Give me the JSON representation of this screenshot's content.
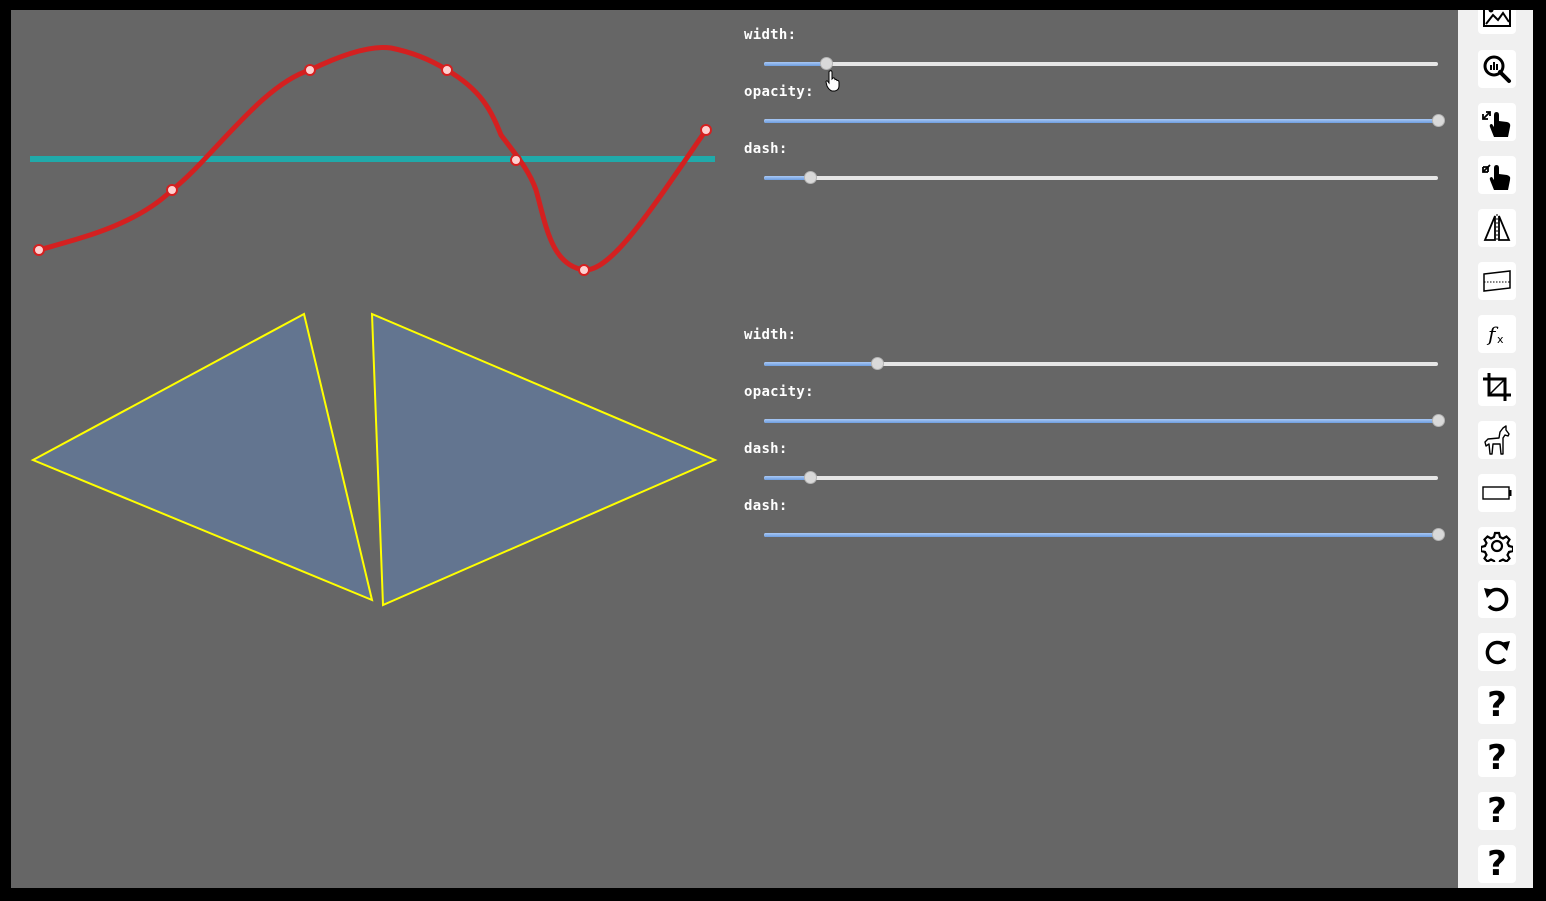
{
  "canvas": {
    "background": "#666666",
    "curve_color": "#d42020",
    "line_color": "#20aaaa",
    "triangle_fill": "#637590",
    "triangle_stroke": "#ffff00"
  },
  "panel1": {
    "sliders": [
      {
        "label": "width:",
        "value": 0.092
      },
      {
        "label": "opacity:",
        "value": 1.0
      },
      {
        "label": "dash:",
        "value": 0.068
      }
    ]
  },
  "panel2": {
    "sliders": [
      {
        "label": "width:",
        "value": 0.168
      },
      {
        "label": "opacity:",
        "value": 1.0
      },
      {
        "label": "dash:",
        "value": 0.068
      },
      {
        "label": "dash:",
        "value": 1.0
      }
    ]
  },
  "toolbar": {
    "tools": [
      {
        "icon": "image-icon"
      },
      {
        "icon": "zoom-chart-icon"
      },
      {
        "icon": "hand-expand-icon"
      },
      {
        "icon": "hand-shrink-icon"
      },
      {
        "icon": "mirror-icon"
      },
      {
        "icon": "skew-rect-icon"
      },
      {
        "icon": "function-icon",
        "text": "fx"
      },
      {
        "icon": "crop-icon"
      },
      {
        "icon": "horse-icon"
      },
      {
        "icon": "battery-icon"
      },
      {
        "icon": "gear-icon"
      },
      {
        "icon": "undo-icon"
      },
      {
        "icon": "redo-icon"
      },
      {
        "icon": "help-icon",
        "text": "?"
      },
      {
        "icon": "help-icon",
        "text": "?"
      },
      {
        "icon": "help-icon",
        "text": "?"
      },
      {
        "icon": "help-icon",
        "text": "?"
      }
    ]
  }
}
